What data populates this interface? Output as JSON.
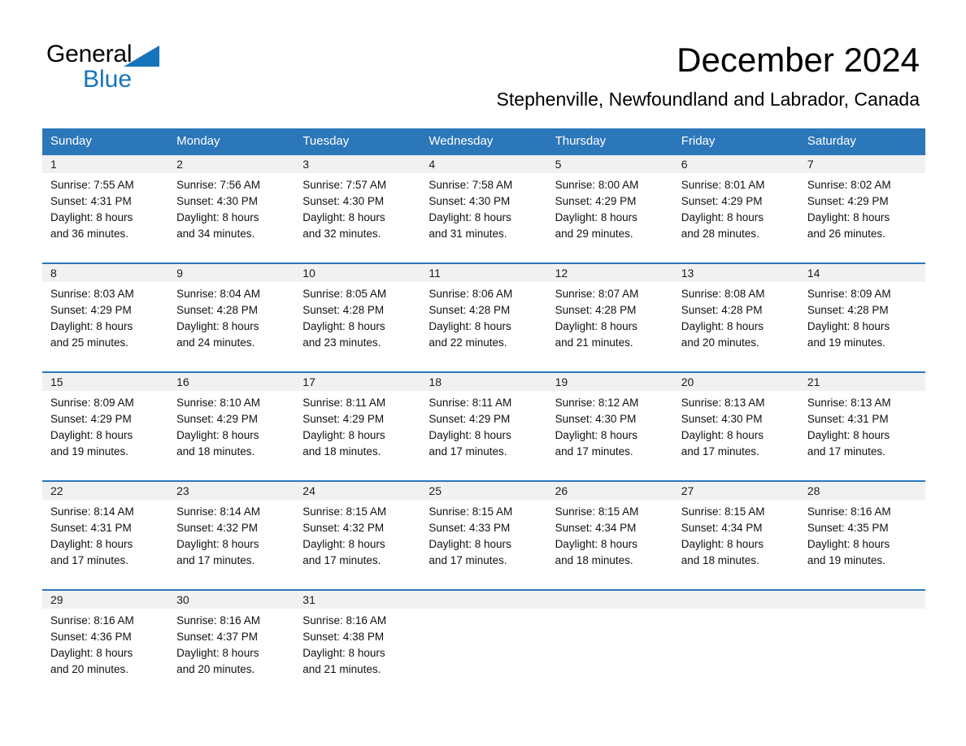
{
  "brand": {
    "name_part1": "General",
    "name_part2": "Blue",
    "accent_color": "#1574bb",
    "triangle_icon": "triangle-icon"
  },
  "header": {
    "title": "December 2024",
    "subtitle": "Stephenville, Newfoundland and Labrador, Canada"
  },
  "calendar": {
    "header_bg": "#2c77ba",
    "header_text_color": "#ffffff",
    "daynum_bg": "#f1f1f1",
    "weekdays": [
      "Sunday",
      "Monday",
      "Tuesday",
      "Wednesday",
      "Thursday",
      "Friday",
      "Saturday"
    ],
    "weeks": [
      [
        {
          "day": "1",
          "sunrise": "Sunrise: 7:55 AM",
          "sunset": "Sunset: 4:31 PM",
          "daylight_line1": "Daylight: 8 hours",
          "daylight_line2": "and 36 minutes."
        },
        {
          "day": "2",
          "sunrise": "Sunrise: 7:56 AM",
          "sunset": "Sunset: 4:30 PM",
          "daylight_line1": "Daylight: 8 hours",
          "daylight_line2": "and 34 minutes."
        },
        {
          "day": "3",
          "sunrise": "Sunrise: 7:57 AM",
          "sunset": "Sunset: 4:30 PM",
          "daylight_line1": "Daylight: 8 hours",
          "daylight_line2": "and 32 minutes."
        },
        {
          "day": "4",
          "sunrise": "Sunrise: 7:58 AM",
          "sunset": "Sunset: 4:30 PM",
          "daylight_line1": "Daylight: 8 hours",
          "daylight_line2": "and 31 minutes."
        },
        {
          "day": "5",
          "sunrise": "Sunrise: 8:00 AM",
          "sunset": "Sunset: 4:29 PM",
          "daylight_line1": "Daylight: 8 hours",
          "daylight_line2": "and 29 minutes."
        },
        {
          "day": "6",
          "sunrise": "Sunrise: 8:01 AM",
          "sunset": "Sunset: 4:29 PM",
          "daylight_line1": "Daylight: 8 hours",
          "daylight_line2": "and 28 minutes."
        },
        {
          "day": "7",
          "sunrise": "Sunrise: 8:02 AM",
          "sunset": "Sunset: 4:29 PM",
          "daylight_line1": "Daylight: 8 hours",
          "daylight_line2": "and 26 minutes."
        }
      ],
      [
        {
          "day": "8",
          "sunrise": "Sunrise: 8:03 AM",
          "sunset": "Sunset: 4:29 PM",
          "daylight_line1": "Daylight: 8 hours",
          "daylight_line2": "and 25 minutes."
        },
        {
          "day": "9",
          "sunrise": "Sunrise: 8:04 AM",
          "sunset": "Sunset: 4:28 PM",
          "daylight_line1": "Daylight: 8 hours",
          "daylight_line2": "and 24 minutes."
        },
        {
          "day": "10",
          "sunrise": "Sunrise: 8:05 AM",
          "sunset": "Sunset: 4:28 PM",
          "daylight_line1": "Daylight: 8 hours",
          "daylight_line2": "and 23 minutes."
        },
        {
          "day": "11",
          "sunrise": "Sunrise: 8:06 AM",
          "sunset": "Sunset: 4:28 PM",
          "daylight_line1": "Daylight: 8 hours",
          "daylight_line2": "and 22 minutes."
        },
        {
          "day": "12",
          "sunrise": "Sunrise: 8:07 AM",
          "sunset": "Sunset: 4:28 PM",
          "daylight_line1": "Daylight: 8 hours",
          "daylight_line2": "and 21 minutes."
        },
        {
          "day": "13",
          "sunrise": "Sunrise: 8:08 AM",
          "sunset": "Sunset: 4:28 PM",
          "daylight_line1": "Daylight: 8 hours",
          "daylight_line2": "and 20 minutes."
        },
        {
          "day": "14",
          "sunrise": "Sunrise: 8:09 AM",
          "sunset": "Sunset: 4:28 PM",
          "daylight_line1": "Daylight: 8 hours",
          "daylight_line2": "and 19 minutes."
        }
      ],
      [
        {
          "day": "15",
          "sunrise": "Sunrise: 8:09 AM",
          "sunset": "Sunset: 4:29 PM",
          "daylight_line1": "Daylight: 8 hours",
          "daylight_line2": "and 19 minutes."
        },
        {
          "day": "16",
          "sunrise": "Sunrise: 8:10 AM",
          "sunset": "Sunset: 4:29 PM",
          "daylight_line1": "Daylight: 8 hours",
          "daylight_line2": "and 18 minutes."
        },
        {
          "day": "17",
          "sunrise": "Sunrise: 8:11 AM",
          "sunset": "Sunset: 4:29 PM",
          "daylight_line1": "Daylight: 8 hours",
          "daylight_line2": "and 18 minutes."
        },
        {
          "day": "18",
          "sunrise": "Sunrise: 8:11 AM",
          "sunset": "Sunset: 4:29 PM",
          "daylight_line1": "Daylight: 8 hours",
          "daylight_line2": "and 17 minutes."
        },
        {
          "day": "19",
          "sunrise": "Sunrise: 8:12 AM",
          "sunset": "Sunset: 4:30 PM",
          "daylight_line1": "Daylight: 8 hours",
          "daylight_line2": "and 17 minutes."
        },
        {
          "day": "20",
          "sunrise": "Sunrise: 8:13 AM",
          "sunset": "Sunset: 4:30 PM",
          "daylight_line1": "Daylight: 8 hours",
          "daylight_line2": "and 17 minutes."
        },
        {
          "day": "21",
          "sunrise": "Sunrise: 8:13 AM",
          "sunset": "Sunset: 4:31 PM",
          "daylight_line1": "Daylight: 8 hours",
          "daylight_line2": "and 17 minutes."
        }
      ],
      [
        {
          "day": "22",
          "sunrise": "Sunrise: 8:14 AM",
          "sunset": "Sunset: 4:31 PM",
          "daylight_line1": "Daylight: 8 hours",
          "daylight_line2": "and 17 minutes."
        },
        {
          "day": "23",
          "sunrise": "Sunrise: 8:14 AM",
          "sunset": "Sunset: 4:32 PM",
          "daylight_line1": "Daylight: 8 hours",
          "daylight_line2": "and 17 minutes."
        },
        {
          "day": "24",
          "sunrise": "Sunrise: 8:15 AM",
          "sunset": "Sunset: 4:32 PM",
          "daylight_line1": "Daylight: 8 hours",
          "daylight_line2": "and 17 minutes."
        },
        {
          "day": "25",
          "sunrise": "Sunrise: 8:15 AM",
          "sunset": "Sunset: 4:33 PM",
          "daylight_line1": "Daylight: 8 hours",
          "daylight_line2": "and 17 minutes."
        },
        {
          "day": "26",
          "sunrise": "Sunrise: 8:15 AM",
          "sunset": "Sunset: 4:34 PM",
          "daylight_line1": "Daylight: 8 hours",
          "daylight_line2": "and 18 minutes."
        },
        {
          "day": "27",
          "sunrise": "Sunrise: 8:15 AM",
          "sunset": "Sunset: 4:34 PM",
          "daylight_line1": "Daylight: 8 hours",
          "daylight_line2": "and 18 minutes."
        },
        {
          "day": "28",
          "sunrise": "Sunrise: 8:16 AM",
          "sunset": "Sunset: 4:35 PM",
          "daylight_line1": "Daylight: 8 hours",
          "daylight_line2": "and 19 minutes."
        }
      ],
      [
        {
          "day": "29",
          "sunrise": "Sunrise: 8:16 AM",
          "sunset": "Sunset: 4:36 PM",
          "daylight_line1": "Daylight: 8 hours",
          "daylight_line2": "and 20 minutes."
        },
        {
          "day": "30",
          "sunrise": "Sunrise: 8:16 AM",
          "sunset": "Sunset: 4:37 PM",
          "daylight_line1": "Daylight: 8 hours",
          "daylight_line2": "and 20 minutes."
        },
        {
          "day": "31",
          "sunrise": "Sunrise: 8:16 AM",
          "sunset": "Sunset: 4:38 PM",
          "daylight_line1": "Daylight: 8 hours",
          "daylight_line2": "and 21 minutes."
        },
        {
          "day": "",
          "sunrise": "",
          "sunset": "",
          "daylight_line1": "",
          "daylight_line2": ""
        },
        {
          "day": "",
          "sunrise": "",
          "sunset": "",
          "daylight_line1": "",
          "daylight_line2": ""
        },
        {
          "day": "",
          "sunrise": "",
          "sunset": "",
          "daylight_line1": "",
          "daylight_line2": ""
        },
        {
          "day": "",
          "sunrise": "",
          "sunset": "",
          "daylight_line1": "",
          "daylight_line2": ""
        }
      ]
    ]
  }
}
